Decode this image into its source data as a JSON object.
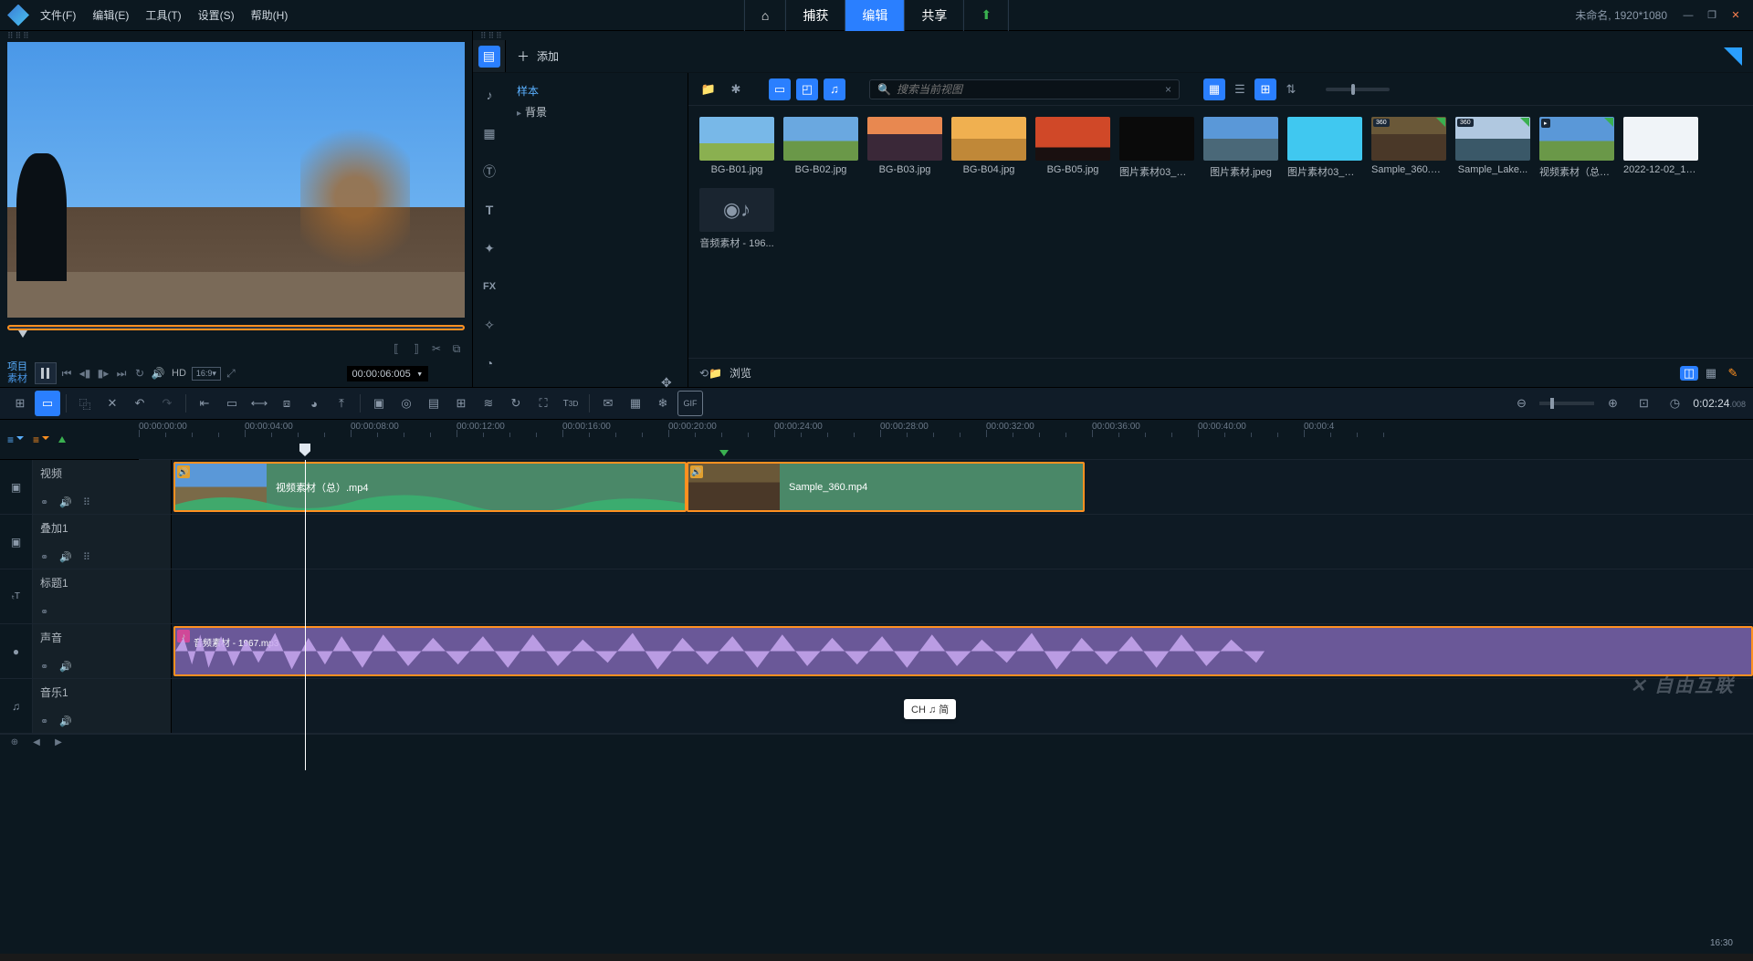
{
  "menu": {
    "file": "文件(F)",
    "edit": "编辑(E)",
    "tools": "工具(T)",
    "settings": "设置(S)",
    "help": "帮助(H)"
  },
  "tabs": {
    "capture": "捕获",
    "edit": "编辑",
    "share": "共享"
  },
  "project": {
    "name": "未命名",
    "resolution": "1920*1080"
  },
  "preview": {
    "label_project": "项目",
    "label_clip": "素材",
    "hd": "HD",
    "ratio": "16:9",
    "timecode": "00:00:06:005"
  },
  "library": {
    "add": "添加",
    "tree": {
      "sample": "样本",
      "background": "背景"
    },
    "search_placeholder": "搜索当前视图",
    "browse": "浏览"
  },
  "media": [
    {
      "label": "BG-B01.jpg",
      "bg": "linear-gradient(180deg,#78b8e8 60%,#8ab050 60%)",
      "badge": null
    },
    {
      "label": "BG-B02.jpg",
      "bg": "linear-gradient(180deg,#6aa8e0 55%,#6a9848 55%)",
      "badge": null
    },
    {
      "label": "BG-B03.jpg",
      "bg": "linear-gradient(180deg,#e88850 40%,#3a2838 40%)",
      "badge": null
    },
    {
      "label": "BG-B04.jpg",
      "bg": "linear-gradient(180deg,#f0b050 50%,#c08838 50%)",
      "badge": null
    },
    {
      "label": "BG-B05.jpg",
      "bg": "linear-gradient(180deg,#d04828 70%,#1a1010 70%)",
      "badge": null
    },
    {
      "label": "图片素材03_副...",
      "bg": "#0a0a0a",
      "badge": null
    },
    {
      "label": "图片素材.jpeg",
      "bg": "linear-gradient(180deg,#5a98d8 50%,#4a6878 50%)",
      "badge": null
    },
    {
      "label": "图片素材03_副...",
      "bg": "#40c8f0",
      "badge": null
    },
    {
      "label": "Sample_360.m...",
      "bg": "linear-gradient(180deg,#6a5838 40%,#4a3828 40%)",
      "badge": "360",
      "check": true
    },
    {
      "label": "Sample_Lake...",
      "bg": "linear-gradient(180deg,#b0c8e0 50%,#3a5868 50%)",
      "badge": "360",
      "check": true
    },
    {
      "label": "视频素材（总）...",
      "bg": "linear-gradient(180deg,#5a98d8 55%,#6a9848 55%)",
      "badge": "▸",
      "check": true
    },
    {
      "label": "2022-12-02_14...",
      "bg": "#f0f4f8",
      "badge": null
    },
    {
      "label": "音频素材 - 196...",
      "bg": "#1a2530",
      "badge": null,
      "audio": true
    }
  ],
  "timeline": {
    "timecode": "0:02:24",
    "timecode_ms": ".008",
    "ruler": [
      "00:00:00:00",
      "00:00:04:00",
      "00:00:08:00",
      "00:00:12:00",
      "00:00:16:00",
      "00:00:20:00",
      "00:00:24:00",
      "00:00:28:00",
      "00:00:32:00",
      "00:00:36:00",
      "00:00:40:00",
      "00:00:4"
    ],
    "tracks": {
      "video": "视频",
      "overlay": "叠加1",
      "title": "标题1",
      "sound": "声音",
      "music": "音乐1"
    },
    "clips": {
      "video1": "视频素材（总）.mp4",
      "video2": "Sample_360.mp4",
      "audio1": "音频素材 - 1967.mp3"
    },
    "ime_badge": "CH ♫ 简"
  },
  "system_time": "16:30"
}
